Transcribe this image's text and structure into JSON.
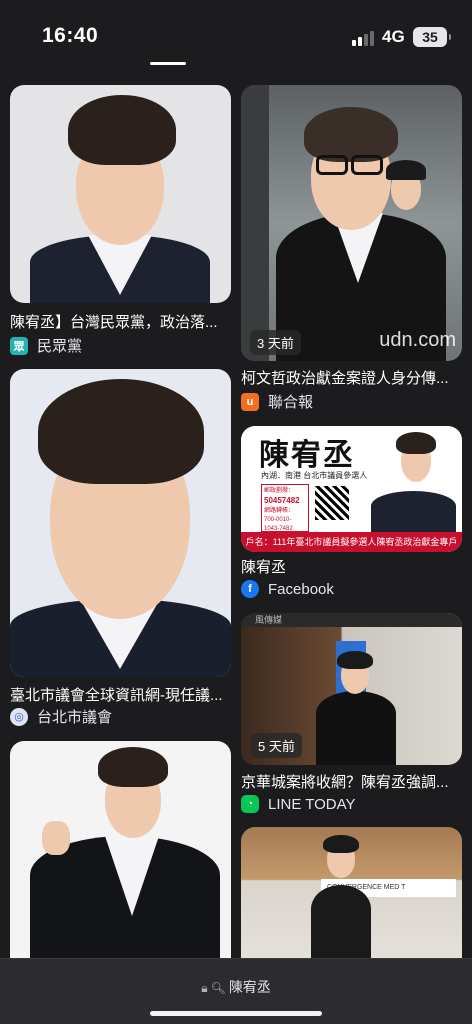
{
  "status_bar": {
    "time": "16:40",
    "network": "4G",
    "battery": "35"
  },
  "results": [
    {
      "caption": "陳宥丞】台灣民眾黨，政治落...",
      "source": "民眾黨",
      "source_icon": "tpp-logo-icon",
      "age": ""
    },
    {
      "caption": "柯文哲政治獻金案證人身分傳...",
      "source": "聯合報",
      "source_icon": "udn-logo-icon",
      "age": "3 天前",
      "watermark": "udn.com"
    },
    {
      "caption": "臺北市議會全球資訊網-現任議...",
      "source": "台北市議會",
      "source_icon": "globe-icon",
      "age": ""
    },
    {
      "caption": "陳宥丞",
      "source": "Facebook",
      "source_icon": "facebook-icon",
      "age": "",
      "poster": {
        "name": "陳宥丞",
        "subtitle": "內湖．南港 台北市議員參選人",
        "phone_label": "郵政劃撥：",
        "phone": "50457482",
        "bank_label": "網路轉帳：",
        "bank": "700-0010-1043-7482",
        "footer": "戶名：111年臺北市議員擬參選人陳宥丞政治獻金專戶"
      }
    },
    {
      "caption": "京華城案將收網？陳宥丞強調...",
      "source": "LINE TODAY",
      "source_icon": "line-today-icon",
      "age": "5 天前",
      "banner": "風傳媒"
    },
    {
      "caption": "",
      "source": "",
      "source_icon": "",
      "age": "",
      "banner": "CONVERGENCE MED T"
    }
  ],
  "address_bar": {
    "query": "陳宥丞"
  },
  "colors": {
    "background": "#1c1c1e",
    "facebook": "#1877f2",
    "udn": "#f26f21",
    "line": "#06c755",
    "poster_red": "#c8102e"
  }
}
